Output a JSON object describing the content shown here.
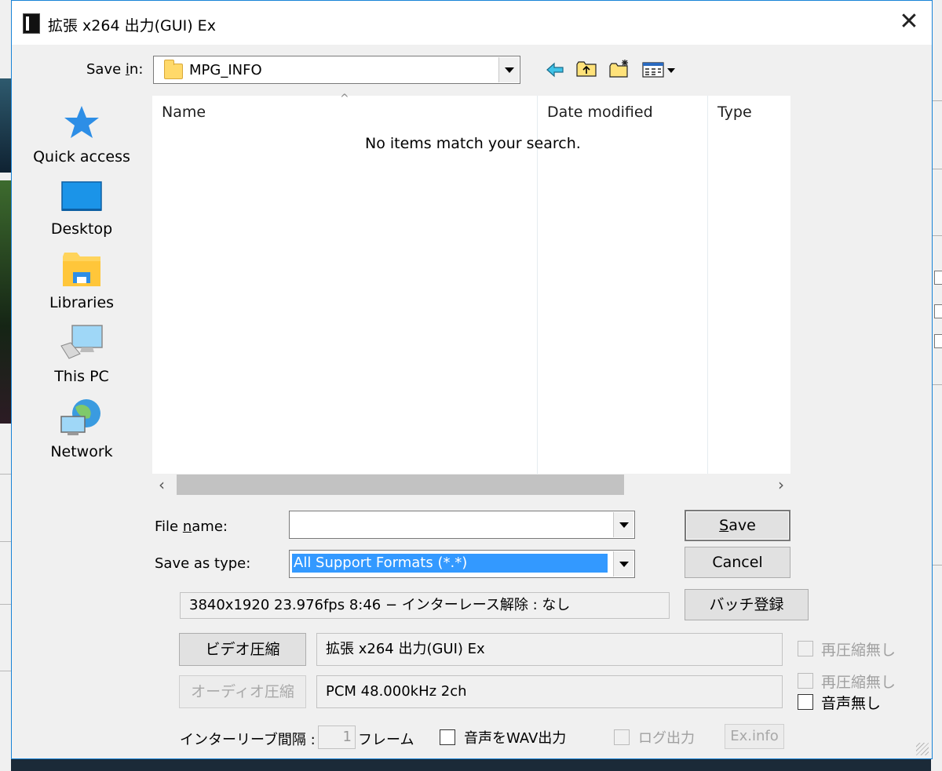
{
  "window": {
    "title": "拡張 x264 出力(GUI) Ex",
    "close_glyph": "✕"
  },
  "save_in": {
    "label_pre": "Save ",
    "label_key": "i",
    "label_post": "n:",
    "value": "MPG_INFO"
  },
  "toolbar_icons": [
    "back-arrow-icon",
    "up-folder-icon",
    "new-folder-icon",
    "view-menu-icon"
  ],
  "places": [
    {
      "label": "Quick access",
      "icon": "star-icon"
    },
    {
      "label": "Desktop",
      "icon": "desktop-icon"
    },
    {
      "label": "Libraries",
      "icon": "libraries-icon"
    },
    {
      "label": "This PC",
      "icon": "computer-icon"
    },
    {
      "label": "Network",
      "icon": "network-icon"
    }
  ],
  "file_list": {
    "columns": [
      "Name",
      "Date modified",
      "Type"
    ],
    "empty_message": "No items match your search.",
    "scroll_left": "‹",
    "scroll_right": "›"
  },
  "file_name": {
    "label_pre": "File ",
    "label_key": "n",
    "label_post": "ame:",
    "value": ""
  },
  "save_as_type": {
    "label": "Save as type:",
    "value": "All Support Formats (*.*)"
  },
  "buttons": {
    "save_key": "S",
    "save_rest": "ave",
    "cancel": "Cancel",
    "batch": "バッチ登録"
  },
  "video_info": "3840x1920  23.976fps  8:46  −  インターレース解除 : なし",
  "video_compress": {
    "button": "ビデオ圧縮",
    "codec": "拡張 x264 出力(GUI) Ex",
    "no_recompress": "再圧縮無し"
  },
  "audio_compress": {
    "button": "オーディオ圧縮",
    "codec": "PCM 48.000kHz 2ch",
    "no_recompress": "再圧縮無し",
    "no_audio": "音声無し"
  },
  "interleave": {
    "label": "インターリーブ間隔 :",
    "value": "1",
    "unit": "フレーム"
  },
  "wav_output": "音声をWAV出力",
  "log_output": "ログ出力",
  "ex_info": "Ex.info",
  "colors": {
    "accent": "#1883d7",
    "selection": "#3399ff",
    "folder": "#ffd96a"
  }
}
